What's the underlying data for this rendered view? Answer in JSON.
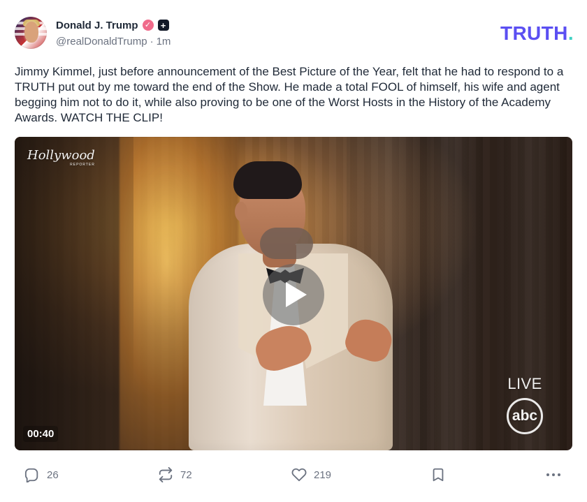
{
  "post": {
    "author": {
      "display_name": "Donald J. Trump",
      "handle": "@realDonaldTrump",
      "time_ago": "1m",
      "separator": "·",
      "verified_icon": "verified-badge-icon",
      "plus_icon": "plus-badge-icon"
    },
    "brand": {
      "logo_text": "TRUTH",
      "logo_dot": "."
    },
    "content": {
      "text": "Jimmy Kimmel, just before announcement of the Best Picture of the Year, felt that he had to respond to a TRUTH put out by me toward the end of the Show. He made a total FOOL of himself, his wife and agent begging him not to do it, while also proving to be one of the Worst Hosts in the History of the Academy Awards. WATCH THE CLIP!"
    },
    "video": {
      "duration": "00:40",
      "watermark_main": "Hollywood",
      "watermark_sub": "REPORTER",
      "live_label": "LIVE",
      "network_logo_text": "abc",
      "play_icon": "play-icon"
    },
    "actions": {
      "reply_count": "26",
      "retruth_count": "72",
      "like_count": "219",
      "reply_icon": "comment-icon",
      "retruth_icon": "repost-icon",
      "like_icon": "heart-icon",
      "bookmark_icon": "bookmark-icon",
      "more_icon": "more-icon"
    }
  },
  "colors": {
    "accent": "#5b4ff2",
    "accent_dot": "#3fd1c3",
    "verified": "#f06b8b",
    "text": "#1f2937",
    "muted": "#6b7280"
  }
}
